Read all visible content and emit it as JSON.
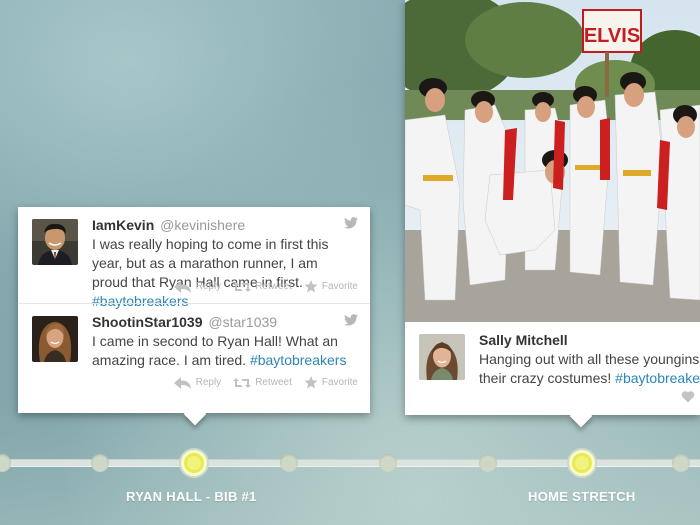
{
  "tweets_left": [
    {
      "name": "IamKevin",
      "handle": "@kevinishere",
      "text": "I was really hoping to come in first this year, but as a marathon runner, I am proud that Ryan Hall came in first.",
      "hashtag": "#baytobreakers",
      "avatar_icon": "man-portrait",
      "reply_label": "Reply",
      "retweet_label": "Retweet",
      "favorite_label": "Favorite"
    },
    {
      "name": "ShootinStar1039",
      "handle": "@star1039",
      "text": "I came in second to Ryan Hall! What an amazing race. I am tired.",
      "hashtag": "#baytobreakers",
      "avatar_icon": "woman-portrait",
      "reply_label": "Reply",
      "retweet_label": "Retweet",
      "favorite_label": "Favorite"
    }
  ],
  "tweet_right": {
    "name": "Sally Mitchell",
    "text": "Hanging out with all these youngins in their crazy costumes!",
    "hashtag": "#baytobreakers",
    "avatar_icon": "woman-portrait"
  },
  "photo": {
    "sign_text": "ELVIS",
    "subject": "runners dressed as Elvis"
  },
  "timeline": {
    "labels": [
      "RYAN HALL - BIB #1",
      "HOME STRETCH"
    ]
  },
  "colors": {
    "hashtag": "#2a85b8",
    "active_dot": "#f1f37f",
    "label": "#ffffff"
  }
}
